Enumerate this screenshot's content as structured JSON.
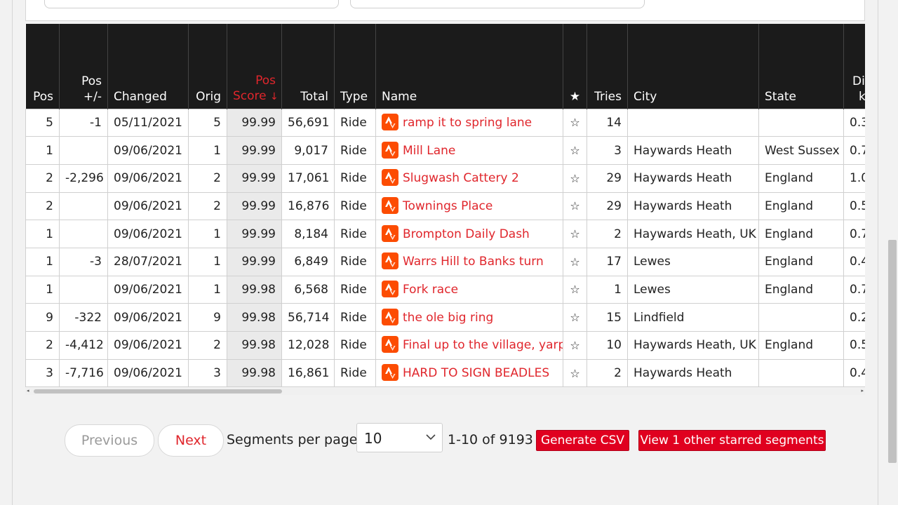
{
  "table": {
    "headers": {
      "pos": "Pos",
      "pos_change_1": "Pos",
      "pos_change_2": "+/-",
      "changed": "Changed",
      "orig": "Orig",
      "pos_score_1": "Pos",
      "pos_score_2": "Score",
      "sort_arrow": "↓",
      "total": "Total",
      "type": "Type",
      "name": "Name",
      "star": "★",
      "tries": "Tries",
      "city": "City",
      "state": "State",
      "dist_1": "Dis",
      "dist_2": "k"
    },
    "rows": [
      {
        "pos": "5",
        "change": "-1",
        "changed": "05/11/2021",
        "orig": "5",
        "score": "99.99",
        "total": "56,691",
        "type": "Ride",
        "name": "ramp it to spring lane",
        "star": "☆",
        "tries": "14",
        "city": "",
        "state": "",
        "dist": "0.3"
      },
      {
        "pos": "1",
        "change": "",
        "changed": "09/06/2021",
        "orig": "1",
        "score": "99.99",
        "total": "9,017",
        "type": "Ride",
        "name": "Mill Lane",
        "star": "☆",
        "tries": "3",
        "city": "Haywards Heath",
        "state": "West Sussex",
        "dist": "0.7"
      },
      {
        "pos": "2",
        "change": "-2,296",
        "changed": "09/06/2021",
        "orig": "2",
        "score": "99.99",
        "total": "17,061",
        "type": "Ride",
        "name": "Slugwash Cattery 2",
        "star": "☆",
        "tries": "29",
        "city": "Haywards Heath",
        "state": "England",
        "dist": "1.0"
      },
      {
        "pos": "2",
        "change": "",
        "changed": "09/06/2021",
        "orig": "2",
        "score": "99.99",
        "total": "16,876",
        "type": "Ride",
        "name": "Townings Place",
        "star": "☆",
        "tries": "29",
        "city": "Haywards Heath",
        "state": "England",
        "dist": "0.5"
      },
      {
        "pos": "1",
        "change": "",
        "changed": "09/06/2021",
        "orig": "1",
        "score": "99.99",
        "total": "8,184",
        "type": "Ride",
        "name": "Brompton Daily Dash",
        "star": "☆",
        "tries": "2",
        "city": "Haywards Heath, UK",
        "state": "England",
        "dist": "0.7"
      },
      {
        "pos": "1",
        "change": "-3",
        "changed": "28/07/2021",
        "orig": "1",
        "score": "99.99",
        "total": "6,849",
        "type": "Ride",
        "name": "Warrs Hill to Banks turn",
        "star": "☆",
        "tries": "17",
        "city": "Lewes",
        "state": "England",
        "dist": "0.4"
      },
      {
        "pos": "1",
        "change": "",
        "changed": "09/06/2021",
        "orig": "1",
        "score": "99.98",
        "total": "6,568",
        "type": "Ride",
        "name": "Fork race",
        "star": "☆",
        "tries": "1",
        "city": "Lewes",
        "state": "England",
        "dist": "0.7"
      },
      {
        "pos": "9",
        "change": "-322",
        "changed": "09/06/2021",
        "orig": "9",
        "score": "99.98",
        "total": "56,714",
        "type": "Ride",
        "name": "the ole big ring",
        "star": "☆",
        "tries": "15",
        "city": "Lindfield",
        "state": "",
        "dist": "0.2"
      },
      {
        "pos": "2",
        "change": "-4,412",
        "changed": "09/06/2021",
        "orig": "2",
        "score": "99.98",
        "total": "12,028",
        "type": "Ride",
        "name": "Final up to the village, yarp",
        "star": "☆",
        "tries": "10",
        "city": "Haywards Heath, UK",
        "state": "England",
        "dist": "0.5"
      },
      {
        "pos": "3",
        "change": "-7,716",
        "changed": "09/06/2021",
        "orig": "3",
        "score": "99.98",
        "total": "16,861",
        "type": "Ride",
        "name": "HARD TO SIGN BEADLES",
        "star": "☆",
        "tries": "2",
        "city": "Haywards Heath",
        "state": "",
        "dist": "0.4"
      }
    ]
  },
  "pager": {
    "previous_label": "Previous",
    "next_label": "Next",
    "per_page_label": "Segments per page:",
    "per_page_value": "10",
    "range_text": "1-10 of 9193",
    "csv_label": "Generate CSV",
    "starred_label": "View 1 other starred segments"
  },
  "icons": {
    "segment_icon": "strava-segment-icon",
    "scroll_left": "◂",
    "scroll_right": "▸"
  },
  "colors": {
    "accent_red": "#e0262c",
    "button_red": "#e0001f",
    "strava_orange": "#fc4c02",
    "header_bg": "#1b1b1b"
  }
}
